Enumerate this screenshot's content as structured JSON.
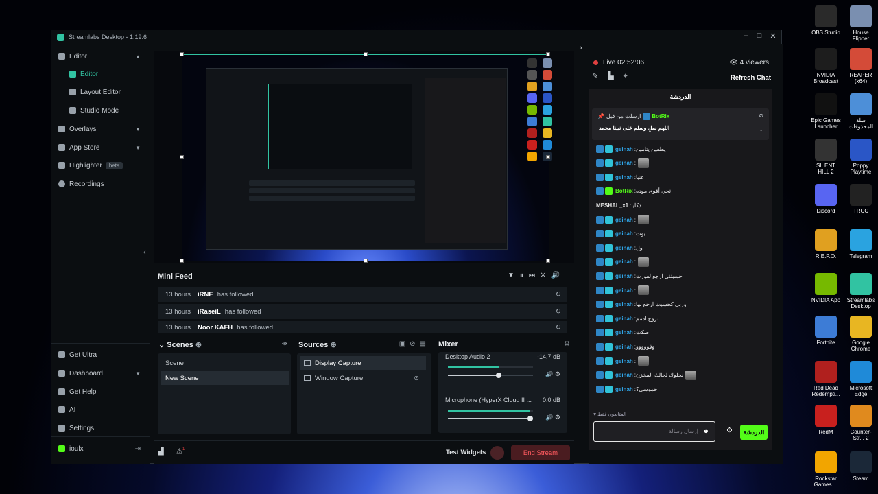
{
  "window": {
    "title": "Streamlabs Desktop - 1.19.6"
  },
  "sidebar": {
    "items": [
      {
        "label": "Editor"
      },
      {
        "label": "Editor"
      },
      {
        "label": "Layout Editor"
      },
      {
        "label": "Studio Mode"
      },
      {
        "label": "Overlays"
      },
      {
        "label": "App Store"
      },
      {
        "label": "Highlighter",
        "badge": "beta"
      },
      {
        "label": "Recordings"
      }
    ],
    "bottom": [
      {
        "label": "Get Ultra"
      },
      {
        "label": "Dashboard"
      },
      {
        "label": "Get Help"
      },
      {
        "label": "AI"
      },
      {
        "label": "Settings"
      }
    ],
    "user": "ioulx"
  },
  "mini_feed": {
    "title": "Mini Feed",
    "rows": [
      {
        "time": "13 hours",
        "name": "iRNE",
        "action": "has followed"
      },
      {
        "time": "13 hours",
        "name": "iRaseiL",
        "action": "has followed"
      },
      {
        "time": "13 hours",
        "name": "Noor KAFH",
        "action": "has followed"
      }
    ]
  },
  "scenes": {
    "title": "Scenes",
    "items": [
      "Scene",
      "New Scene"
    ]
  },
  "sources": {
    "title": "Sources",
    "items": [
      "Display Capture",
      "Window Capture"
    ]
  },
  "mixer": {
    "title": "Mixer",
    "channels": [
      {
        "name": "Desktop Audio 2",
        "db": "-14.7 dB",
        "level": 0.6
      },
      {
        "name": "Microphone (HyperX Cloud II ...",
        "db": "0.0 dB",
        "level": 0.97
      }
    ]
  },
  "footer": {
    "test_widgets": "Test Widgets",
    "end_stream": "End Stream"
  },
  "chat": {
    "live_label": "Live",
    "live_time": "02:52:06",
    "viewers": "4 viewers",
    "refresh": "Refresh Chat",
    "header": "الدردشة",
    "pinned_title": "ارسلت من قبل",
    "pinned_user": "BotRix",
    "pinned_text": "اللهم صلِ وسلم على نبينا محمد",
    "messages": [
      {
        "user": "geinah",
        "text": "يطفين يتامين"
      },
      {
        "user": "geinah",
        "text": ""
      },
      {
        "user": "geinah",
        "text": "عنبا"
      },
      {
        "user": "BotRix",
        "text": "تحي أقوى موده"
      },
      {
        "user": "MESHAL_x1",
        "text": "ذكايا"
      },
      {
        "user": "geinah",
        "text": ""
      },
      {
        "user": "geinah",
        "text": "يوت"
      },
      {
        "user": "geinah",
        "text": "ول"
      },
      {
        "user": "geinah",
        "text": ""
      },
      {
        "user": "geinah",
        "text": "حسبتني ارجع لفورت"
      },
      {
        "user": "geinah",
        "text": ""
      },
      {
        "user": "geinah",
        "text": "وربي كحسيت ارجع لها"
      },
      {
        "user": "geinah",
        "text": "بروح ادمم"
      },
      {
        "user": "geinah",
        "text": "صكت"
      },
      {
        "user": "geinah",
        "text": "وقووووو"
      },
      {
        "user": "geinah",
        "text": ""
      },
      {
        "user": "geinah",
        "text": "نحلوك لحالك المخزن"
      },
      {
        "user": "geinah",
        "text": "حموسي؟"
      }
    ],
    "followers_only": "المتابعون فقط",
    "input_placeholder": "إرسال رسالة",
    "send": "الدردشة"
  },
  "desktop_icons": [
    {
      "label": "OBS Studio",
      "color": "#2a2a2a"
    },
    {
      "label": "House Flipper",
      "color": "#7a8fb0"
    },
    {
      "label": "NVIDIA Broadcast",
      "color": "#1d1d1d"
    },
    {
      "label": "REAPER (x64)",
      "color": "#d44b38"
    },
    {
      "label": "Epic Games Launcher",
      "color": "#111111"
    },
    {
      "label": "سلة المحذوفات",
      "color": "#4d8fd8"
    },
    {
      "label": "SILENT HILL 2",
      "color": "#333333"
    },
    {
      "label": "Poppy Playtime",
      "color": "#2a56c6"
    },
    {
      "label": "Discord",
      "color": "#5865f2"
    },
    {
      "label": "TRCC",
      "color": "#222222"
    },
    {
      "label": "R.E.P.O.",
      "color": "#e0a020"
    },
    {
      "label": "Telegram",
      "color": "#2aa3e0"
    },
    {
      "label": "NVIDIA App",
      "color": "#76b900"
    },
    {
      "label": "Streamlabs Desktop",
      "color": "#31c3a2"
    },
    {
      "label": "Fortnite",
      "color": "#3d7cd6"
    },
    {
      "label": "Google Chrome",
      "color": "#e8b622"
    },
    {
      "label": "Red Dead Redempti...",
      "color": "#b0201e"
    },
    {
      "label": "Microsoft Edge",
      "color": "#1f8ad8"
    },
    {
      "label": "RedM",
      "color": "#c8201e"
    },
    {
      "label": "Counter-Str... 2",
      "color": "#e08a1e"
    },
    {
      "label": "Rockstar Games ...",
      "color": "#f2a500"
    },
    {
      "label": "Steam",
      "color": "#1b2838"
    }
  ]
}
